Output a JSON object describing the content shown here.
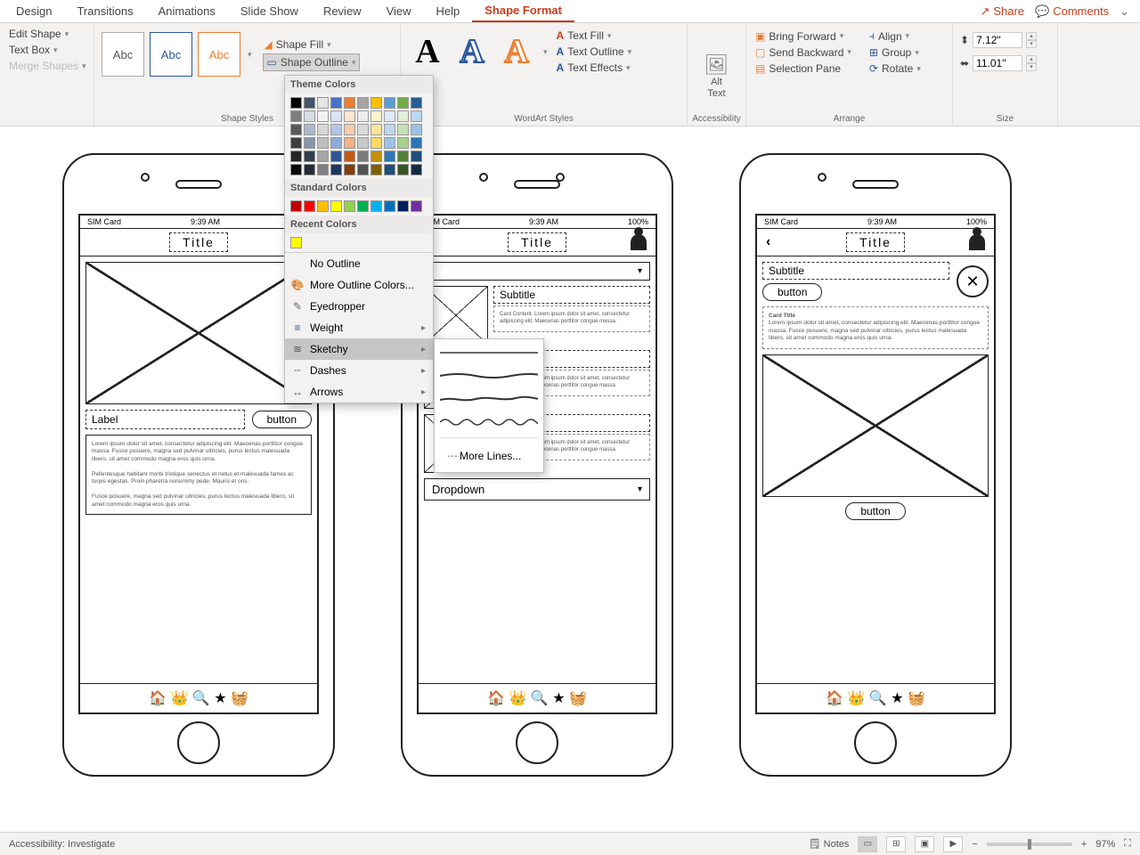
{
  "tabs": [
    "Design",
    "Transitions",
    "Animations",
    "Slide Show",
    "Review",
    "View",
    "Help",
    "Shape Format"
  ],
  "activeTab": "Shape Format",
  "topRight": {
    "share": "Share",
    "comments": "Comments"
  },
  "ribbon": {
    "editGroup": {
      "editShape": "Edit Shape",
      "textBox": "Text Box",
      "mergeShapes": "Merge Shapes"
    },
    "shapeStyles": {
      "abc": "Abc",
      "fill": "Shape Fill",
      "outline": "Shape Outline",
      "label": "Shape Styles"
    },
    "wordArt": {
      "textFill": "Text Fill",
      "textOutline": "Text Outline",
      "textEffects": "Text Effects",
      "label": "WordArt Styles"
    },
    "altText": "Alt Text",
    "accessibility": "Accessibility",
    "arrange": {
      "bringForward": "Bring Forward",
      "sendBackward": "Send Backward",
      "selectionPane": "Selection Pane",
      "align": "Align",
      "group": "Group",
      "rotate": "Rotate",
      "label": "Arrange"
    },
    "size": {
      "height": "7.12\"",
      "width": "11.01\"",
      "label": "Size"
    }
  },
  "outlineMenu": {
    "themeColors": "Theme Colors",
    "standardColors": "Standard Colors",
    "recentColors": "Recent Colors",
    "noOutline": "No Outline",
    "moreColors": "More Outline Colors...",
    "eyedropper": "Eyedropper",
    "weight": "Weight",
    "sketchy": "Sketchy",
    "dashes": "Dashes",
    "arrows": "Arrows",
    "moreLines": "More Lines..."
  },
  "themeColorsRow": [
    "#000000",
    "#44546a",
    "#e7e6e6",
    "#4472c4",
    "#ed7d31",
    "#a5a5a5",
    "#ffc000",
    "#5b9bd5",
    "#70ad47",
    "#255e91"
  ],
  "themeTints": [
    [
      "#7f7f7f",
      "#d6dce4",
      "#f2f2f2",
      "#d9e2f3",
      "#fbe5d5",
      "#ededed",
      "#fff2cc",
      "#deebf6",
      "#e2efd9",
      "#bdd7ee"
    ],
    [
      "#595959",
      "#adb9ca",
      "#d8d8d8",
      "#b4c6e7",
      "#f7cbac",
      "#dbdbdb",
      "#fee599",
      "#bdd7ee",
      "#c5e0b3",
      "#9cc3e5"
    ],
    [
      "#3f3f3f",
      "#8496b0",
      "#bfbfbf",
      "#8eaadb",
      "#f4b183",
      "#c9c9c9",
      "#ffd965",
      "#9cc3e5",
      "#a8d08d",
      "#2e75b5"
    ],
    [
      "#262626",
      "#323f4f",
      "#a5a5a5",
      "#2f5496",
      "#c55a11",
      "#7b7b7b",
      "#bf9000",
      "#2e75b5",
      "#538135",
      "#1f4e79"
    ],
    [
      "#0c0c0c",
      "#222a35",
      "#7f7f7f",
      "#1f3864",
      "#833c0b",
      "#525252",
      "#7f6000",
      "#1f4e79",
      "#375623",
      "#132b44"
    ]
  ],
  "standardColorsRow": [
    "#c00000",
    "#ff0000",
    "#ffc000",
    "#ffff00",
    "#92d050",
    "#00b050",
    "#00b0f0",
    "#0070c0",
    "#002060",
    "#7030a0"
  ],
  "recentColorsRow": [
    "#ffff00"
  ],
  "mock": {
    "statusbar": {
      "sim": "SIM Card",
      "time": "9:39 AM",
      "pct": "100%"
    },
    "title": "Title",
    "subtitle": "Subtitle",
    "label": "Label",
    "button": "button",
    "dropdown": "Dropdown",
    "cardTitle": "Card Title",
    "lorem1": "Lorem ipsum dolor sit amet, consectetur adipiscing elit. Maecenas porttitor congue massa. Fusce posuere, magna sed pulvinar ultricies, purus lectus malesuada libero, sit amet commodo magna eros quis urna.",
    "lorem2": "Pellentesque habitant morbi tristique senectus et netus et malesuada fames ac turpis egestas. Proin pharetra nonummy pede. Mauris et orci.",
    "lorem3": "Fusce posuere, magna sed pulvinar ultricies, purus lectus malesuada libero, sit amet commodo magna eros quis urna.",
    "cardSm": "Card Content. Lorem ipsum dolor sit amet, consectetur adipiscing elit. Maecenas porttitor congue massa."
  },
  "status": {
    "left": "Accessibility: Investigate",
    "notes": "Notes",
    "zoom": "97%"
  }
}
